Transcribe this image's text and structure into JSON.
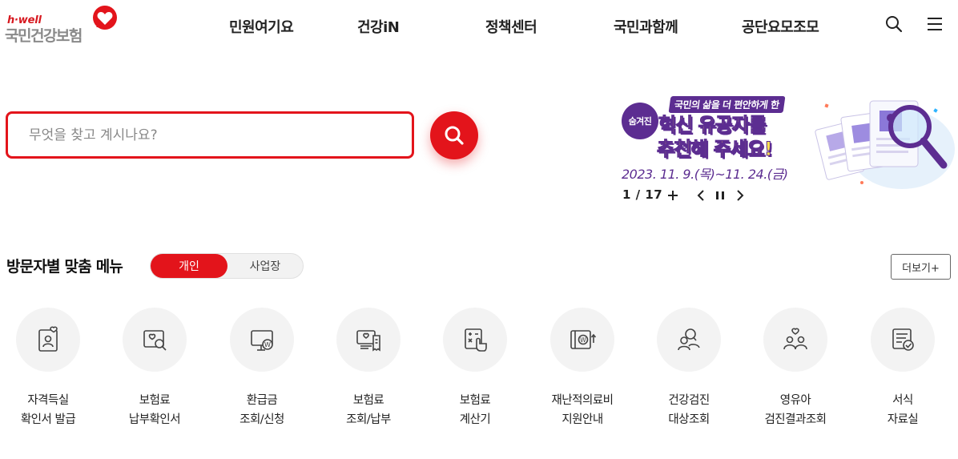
{
  "logo": {
    "small": "h·well",
    "name": "국민건강보험"
  },
  "nav": [
    {
      "label": "민원여기요"
    },
    {
      "label": "건강iN"
    },
    {
      "label": "정책센터"
    },
    {
      "label": "국민과함께"
    },
    {
      "label": "공단요모조모"
    }
  ],
  "search": {
    "placeholder": "무엇을 찾고 계시나요?",
    "value": ""
  },
  "banner": {
    "tag": "숨겨진",
    "subtitle": "국민의 삶을 더 편안하게 한",
    "title_line1": "혁신 유공자를",
    "title_line2": "추천해 주세요!",
    "date": "2023. 11. 9.(목)~11. 24.(금)",
    "pager": "1 / 17"
  },
  "section": {
    "title": "방문자별 맞춤 메뉴",
    "tab_personal": "개인",
    "tab_business": "사업장",
    "more": "더보기+"
  },
  "menu": [
    {
      "line1": "자격득실",
      "line2": "확인서 발급",
      "icon": "id-card-heart-icon"
    },
    {
      "line1": "보험료",
      "line2": "납부확인서",
      "icon": "card-search-icon"
    },
    {
      "line1": "환급금",
      "line2": "조회/신청",
      "icon": "monitor-won-icon"
    },
    {
      "line1": "보험료",
      "line2": "조회/납부",
      "icon": "screen-receipt-icon"
    },
    {
      "line1": "보험료",
      "line2": "계산기",
      "icon": "calculator-hand-icon"
    },
    {
      "line1": "재난적의료비",
      "line2": "지원안내",
      "icon": "wallet-won-icon"
    },
    {
      "line1": "건강검진",
      "line2": "대상조회",
      "icon": "people-search-icon"
    },
    {
      "line1": "영유아",
      "line2": "검진결과조회",
      "icon": "family-heart-icon"
    },
    {
      "line1": "서식",
      "line2": "자료실",
      "icon": "document-check-icon"
    }
  ],
  "colors": {
    "brand_red": "#e3141b",
    "banner_purple": "#5c2d91",
    "banner_yellow": "#ffe14d"
  }
}
